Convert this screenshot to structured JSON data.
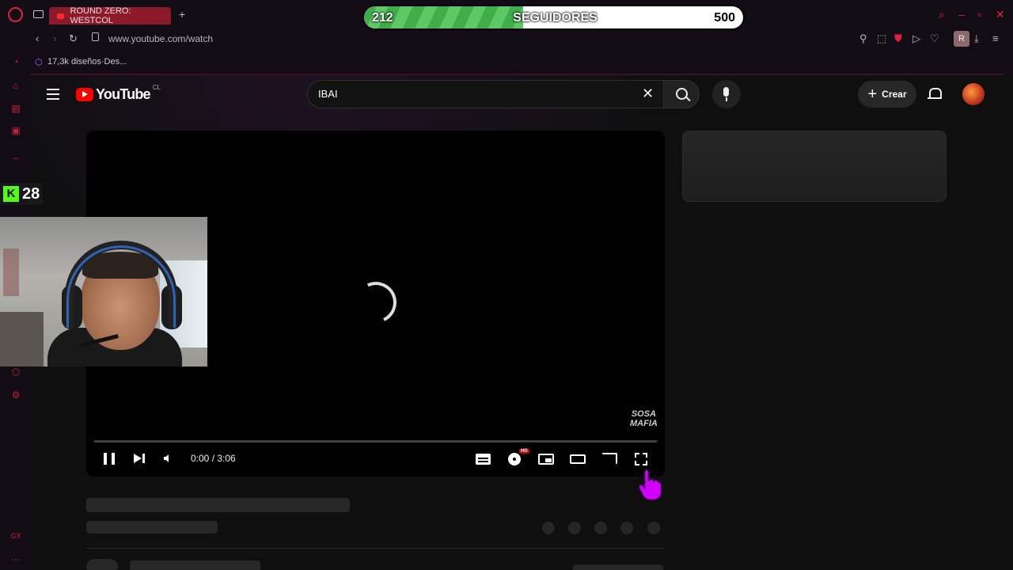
{
  "browser": {
    "tab_title": "ROUND ZERO: WESTCOL",
    "new_tab": "+",
    "url": "www.youtube.com/watch",
    "bookmark": "17,3k diseños·Des...",
    "profile_letter": "R"
  },
  "overlay": {
    "followers_current": "212",
    "followers_label": "SEGUIDORES",
    "followers_goal": "500",
    "followers_progress_fraction": 0.42,
    "viewer_count": "28",
    "viewer_platform_icon": "kick-icon"
  },
  "youtube": {
    "logo_text": "YouTube",
    "country_code": "CL",
    "search_value": "IBAI",
    "create_label": "Crear",
    "create_icon": "+",
    "player": {
      "time": "0:00 / 3:06",
      "watermark_line1": "SOSA",
      "watermark_line2": "MAFIA",
      "hd_badge": "HD",
      "state": "loading"
    }
  },
  "colors": {
    "accent": "#e0203e",
    "youtube_red": "#ff0000",
    "progress_green": "#4bbf55",
    "cursor_magenta": "#d400ff",
    "kick_green": "#53fc18"
  }
}
